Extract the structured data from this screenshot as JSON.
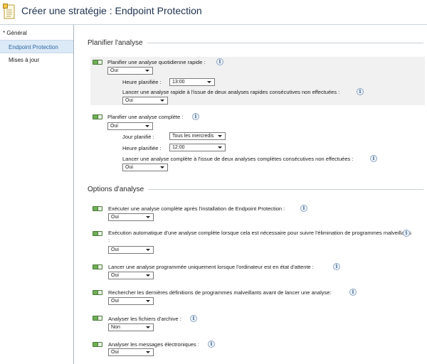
{
  "window": {
    "title": "Créer une stratégie : Endpoint Protection"
  },
  "sidebar": {
    "items": [
      {
        "label": "* Général"
      },
      {
        "label": "Endpoint Protection"
      },
      {
        "label": "Mises à jour"
      }
    ]
  },
  "sections": {
    "schedule": {
      "title": "Planifier l'analyse"
    },
    "options": {
      "title": "Options d'analyse"
    }
  },
  "quick_scan": {
    "label": "Planifier une analyse quotidienne rapide :",
    "value": "Oui",
    "time_label": "Heure planifiée :",
    "time_value": "13:00",
    "missed_label": "Lancer une analyse rapide à l'issue de deux analyses rapides consécutives non effectuées :",
    "missed_value": "Oui"
  },
  "full_scan": {
    "label": "Planifier une analyse complète :",
    "value": "Oui",
    "day_label": "Jour planifié :",
    "day_value": "Tous les mercredis",
    "time_label": "Heure planifiée :",
    "time_value": "12:00",
    "missed_label": "Lancer une analyse complète à l'issue de deux analyses complètes consécutives non effectuées :",
    "missed_value": "Oui"
  },
  "options": [
    {
      "label": "Exécuter une analyse complète après l'installation de Endpoint Protection :",
      "value": "Oui"
    },
    {
      "label": "Exécution automatique d'une analyse complète lorsque cela est nécessaire pour suivre l'élimination de programmes malveillants :",
      "value": "Oui"
    },
    {
      "label": "Lancer une analyse programmée uniquement lorsque l'ordinateur est en état d'attente :",
      "value": "Oui"
    },
    {
      "label": "Rechercher les dernières définitions de programmes malveillants avant de lancer une analyse:",
      "value": "Oui"
    },
    {
      "label": "Analyser les fichiers d'archive :",
      "value": "Non"
    },
    {
      "label": "Analyser les messages électroniques :",
      "value": "Oui"
    }
  ],
  "icons": {
    "info": "info-icon",
    "toggle": "setting-toggle-icon",
    "doc": "policy-document-icon"
  }
}
